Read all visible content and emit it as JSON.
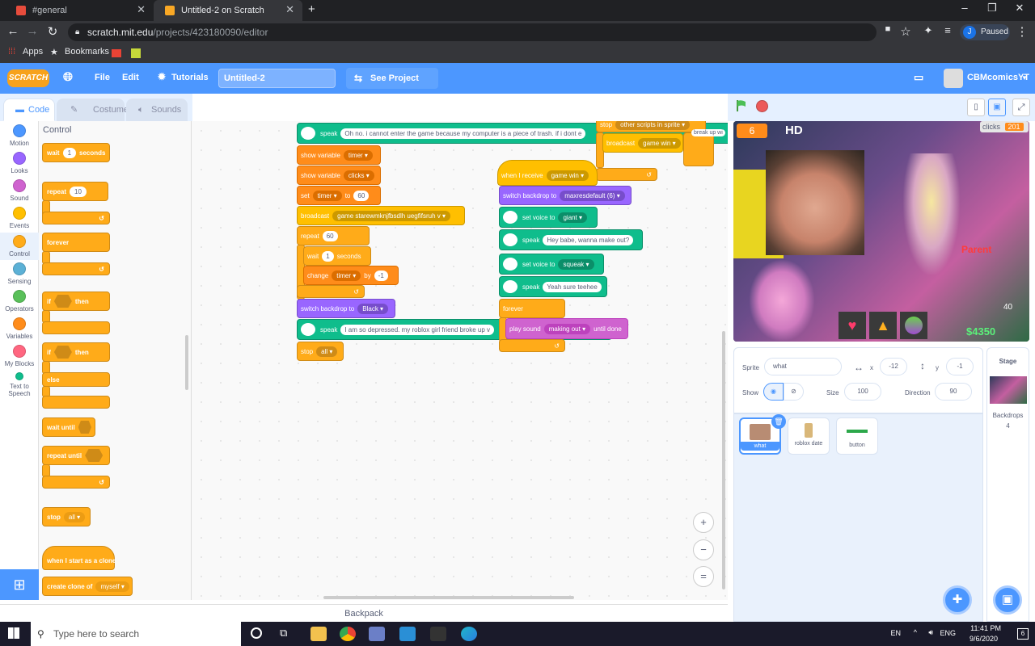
{
  "browser": {
    "tabs": [
      {
        "title": "#general",
        "active": false
      },
      {
        "title": "Untitled-2 on Scratch",
        "active": true
      }
    ],
    "url_host": "scratch.mit.edu",
    "url_path": "/projects/423180090/editor",
    "profile_initial": "J",
    "profile_status": "Paused",
    "bookmarks": [
      "Apps",
      "Bookmarks"
    ]
  },
  "menu": {
    "logo": "SCRATCH",
    "file": "File",
    "edit": "Edit",
    "tutorials": "Tutorials",
    "title_value": "Untitled-2",
    "see_project": "See Project Page",
    "username": "CBMcomicsYT"
  },
  "tabs": {
    "code": "Code",
    "costumes": "Costumes",
    "sounds": "Sounds"
  },
  "categories": [
    {
      "label": "Motion",
      "color": "#4c97ff"
    },
    {
      "label": "Looks",
      "color": "#9966ff"
    },
    {
      "label": "Sound",
      "color": "#cf63cf"
    },
    {
      "label": "Events",
      "color": "#ffbf00"
    },
    {
      "label": "Control",
      "color": "#ffab19"
    },
    {
      "label": "Sensing",
      "color": "#5cb1d6"
    },
    {
      "label": "Operators",
      "color": "#59c059"
    },
    {
      "label": "Variables",
      "color": "#ff8c1a"
    },
    {
      "label": "My Blocks",
      "color": "#ff6680"
    },
    {
      "label": "Text to Speech",
      "color": "#0fbd8c"
    }
  ],
  "palette": {
    "heading": "Control",
    "wait": "wait",
    "wait_val": "1",
    "seconds": "seconds",
    "repeat": "repeat",
    "repeat_val": "10",
    "forever": "forever",
    "if": "if",
    "then": "then",
    "else": "else",
    "wait_until": "wait until",
    "repeat_until": "repeat until",
    "stop": "stop",
    "stop_val": "all",
    "clone_start": "when I start as a clone",
    "create_clone": "create clone of",
    "create_clone_val": "myself"
  },
  "scripts": {
    "speak1": "speak",
    "speak1_text": "Oh no. i cannot enter the game because my computer is a piece of trash. if i dont e",
    "show_var": "show variable",
    "show_var1": "timer",
    "show_var2": "clicks",
    "set": "set",
    "set_var": "timer",
    "to": "to",
    "set_val": "60",
    "broadcast": "broadcast",
    "broadcast_val": "game starewmknjfbsdlh uegfifsruh v",
    "repeat": "repeat",
    "repeat_val": "60",
    "wait": "wait",
    "wait_val": "1",
    "seconds": "seconds",
    "change": "change",
    "change_var": "timer",
    "by": "by",
    "change_val": "-1",
    "switch_bd": "switch backdrop to",
    "switch_bd_val": "Black",
    "speak2": "speak",
    "speak2_text": "I am so depressed. my roblox girl friend broke up v",
    "stop": "stop",
    "stop_val": "all",
    "stop_top": "stop",
    "stop_top_val": "other scripts in sprite",
    "broadcast2": "broadcast",
    "broadcast2_val": "game win",
    "speak_top_tail": "break up wi",
    "when_receive": "when I receive",
    "when_receive_val": "game win",
    "switch_bd2": "switch backdrop to",
    "switch_bd2_val": "maxresdefault (6)",
    "set_voice": "set voice to",
    "voice1": "giant",
    "voice2": "squeak",
    "speak": "speak",
    "speak3_text": "Hey babe, wanna make out?",
    "speak4_text": "Yeah sure teehee",
    "forever": "forever",
    "play_sound": "play sound",
    "play_sound_val": "making out",
    "until_done": "until done"
  },
  "zoom": {
    "in": "+",
    "out": "−",
    "reset": "="
  },
  "backpack": "Backpack",
  "stage": {
    "timer_value": "6",
    "hd": "HD",
    "clicks_label": "clicks",
    "clicks_value": "201",
    "parent_text": "Parent",
    "money": "$4350",
    "level": "40"
  },
  "sprite_info": {
    "sprite_label": "Sprite",
    "sprite_name": "what",
    "x_label": "x",
    "x_val": "-12",
    "y_label": "y",
    "y_val": "-1",
    "show_label": "Show",
    "size_label": "Size",
    "size_val": "100",
    "direction_label": "Direction",
    "direction_val": "90"
  },
  "sprites": [
    {
      "name": "what",
      "selected": true
    },
    {
      "name": "roblox date",
      "selected": false
    },
    {
      "name": "button",
      "selected": false
    }
  ],
  "stage_panel": {
    "title": "Stage",
    "backdrops_label": "Backdrops",
    "backdrops_count": "4"
  },
  "taskbar": {
    "search_placeholder": "Type here to search",
    "lang1": "EN",
    "lang2": "ENG",
    "time": "11:41 PM",
    "date": "9/6/2020",
    "notif_count": "6"
  }
}
